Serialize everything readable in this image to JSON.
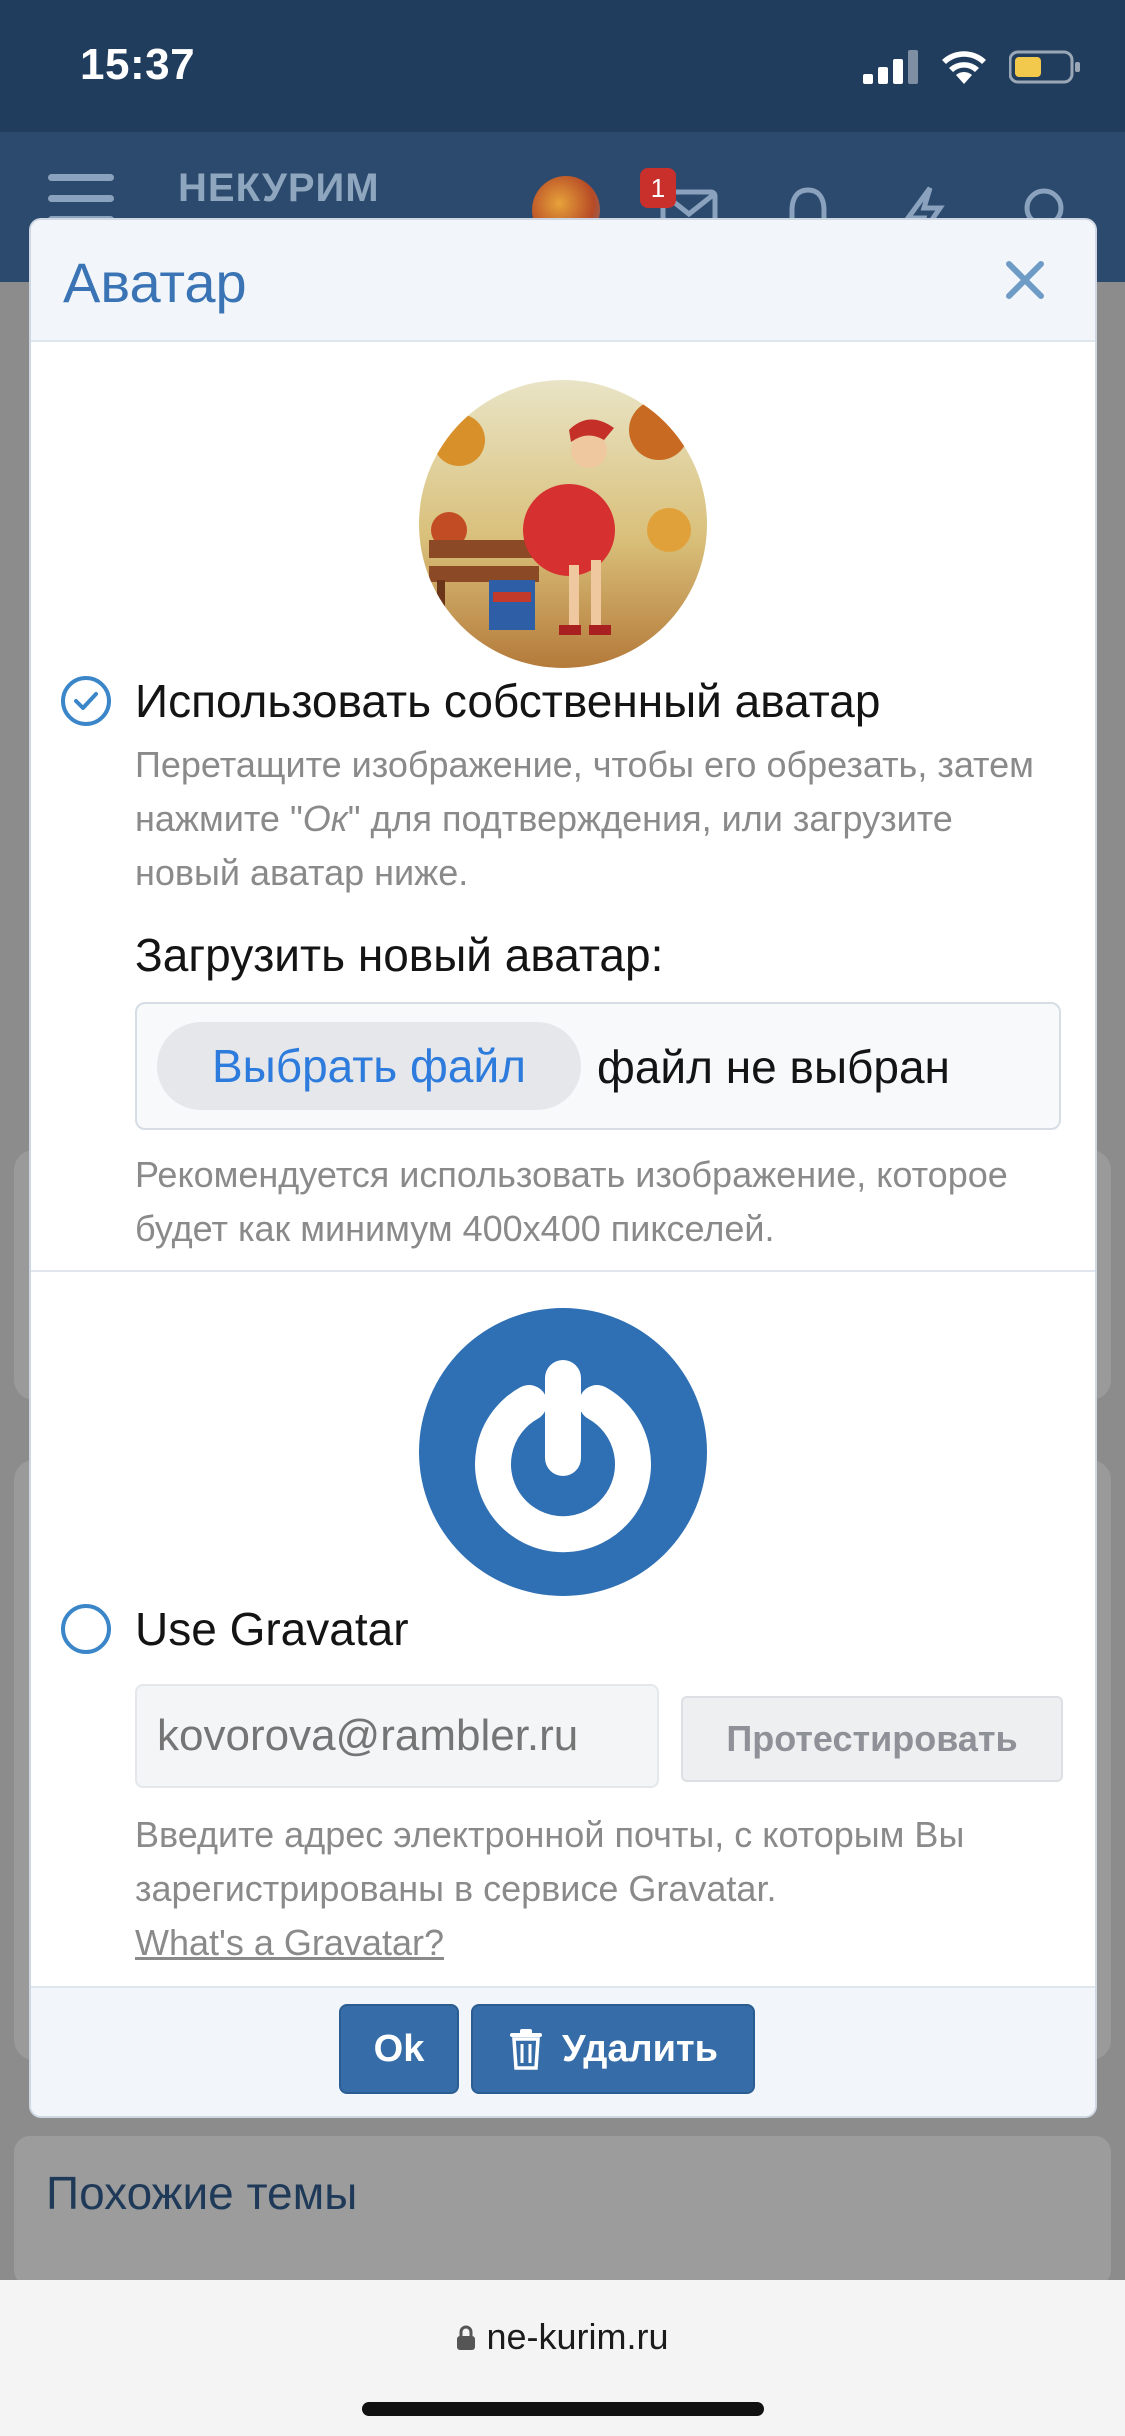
{
  "status": {
    "time": "15:37"
  },
  "header": {
    "logo": "НЕКУРИМ",
    "notification_count": "1"
  },
  "background": {
    "similar_title": "Похожие темы"
  },
  "modal": {
    "title": "Аватар",
    "custom": {
      "label": "Использовать собственный аватар",
      "help_prefix": "Перетащите изображение, чтобы его обрезать, затем нажмите \"",
      "help_ok": "Ок",
      "help_suffix": "\" для подтверждения, или загрузите новый аватар ниже.",
      "upload_label": "Загрузить новый аватар:",
      "file_button": "Выбрать файл",
      "file_status": "файл не выбран",
      "upload_hint": "Рекомендуется использовать изображение, которое будет как минимум 400x400 пикселей.",
      "selected": true
    },
    "gravatar": {
      "label": "Use Gravatar",
      "email_placeholder": "kovorova@rambler.ru",
      "test_button": "Протестировать",
      "help": "Введите адрес электронной почты, с которым Вы зарегистрированы в сервисе Gravatar.",
      "link": "What's a Gravatar?",
      "selected": false
    },
    "ok_button": "Ok",
    "delete_button": "Удалить"
  },
  "browser": {
    "url": "ne-kurim.ru"
  },
  "colors": {
    "accent": "#366da8",
    "header": "#2c4a6d",
    "link_blue": "#2d7bdc"
  }
}
